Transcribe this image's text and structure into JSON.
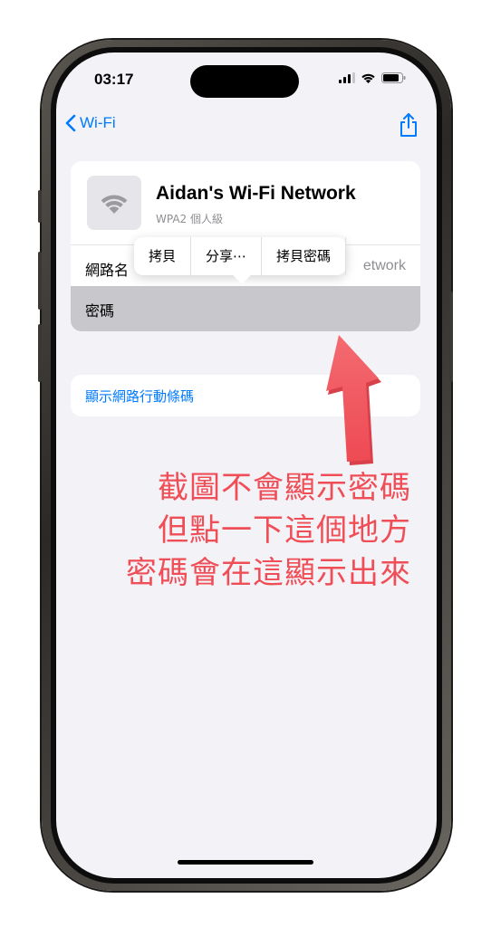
{
  "status_bar": {
    "time": "03:17"
  },
  "nav": {
    "back_label": "Wi-Fi"
  },
  "network": {
    "name": "Aidan's Wi-Fi Network",
    "security": "WPA2 個人級",
    "row_label": "網路名",
    "row_value": "etwork",
    "password_label": "密碼"
  },
  "popover": {
    "items": [
      "拷貝",
      "分享⋯",
      "拷貝密碼"
    ]
  },
  "qr_link": "顯示網路行動條碼",
  "annotation": {
    "lines": [
      "截圖不會顯示密碼",
      "但點一下這個地方",
      "密碼會在這顯示出來"
    ],
    "color": "#f04e57"
  },
  "colors": {
    "accent": "#007aff",
    "background": "#f2f2f7",
    "highlight": "#c7c7cc"
  }
}
